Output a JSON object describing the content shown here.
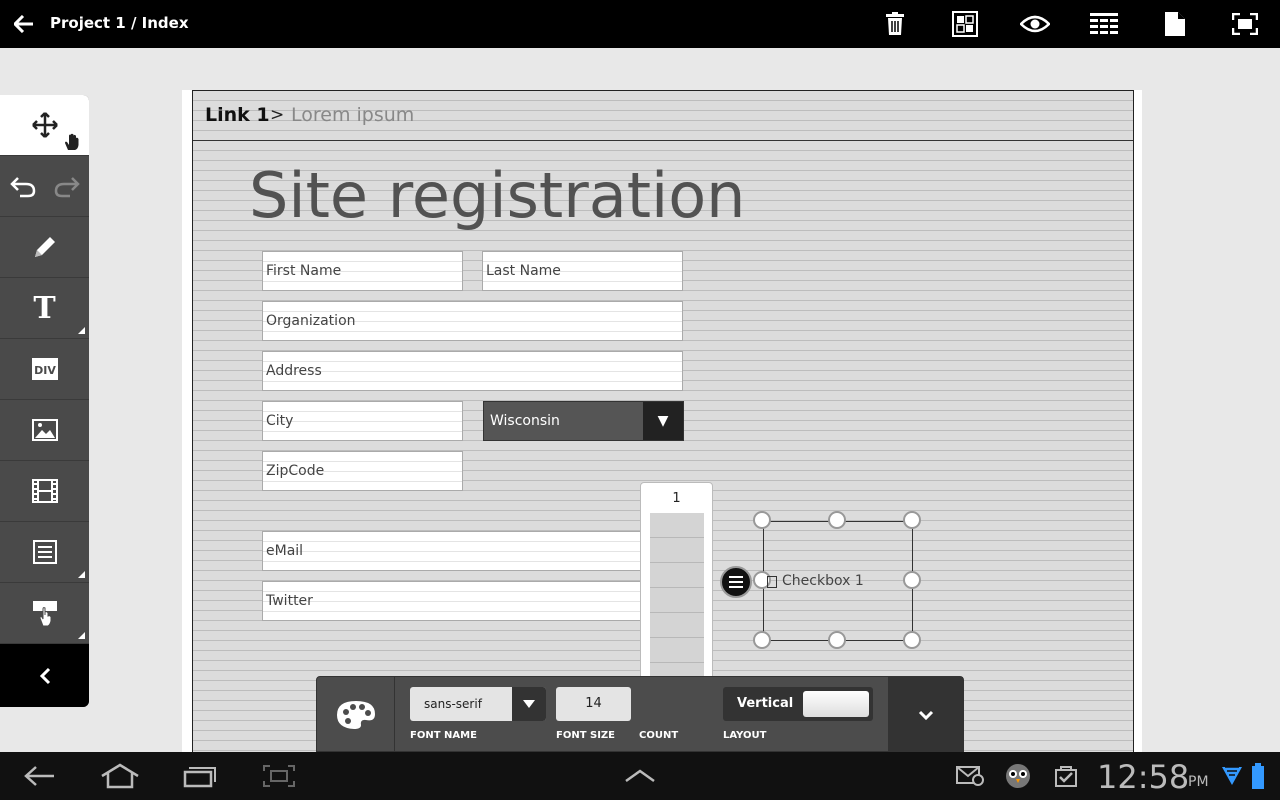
{
  "topbar": {
    "title": "Project 1 / Index",
    "icons": [
      "back-arrow-icon",
      "trash-icon",
      "grid-select-icon",
      "eye-icon",
      "list-grid-icon",
      "document-icon",
      "fullscreen-icon"
    ]
  },
  "breadcrumb": {
    "link": "Link 1",
    "separator": ">",
    "current": "Lorem ipsum"
  },
  "form": {
    "title": "Site registration",
    "first_name": "First Name",
    "last_name": "Last Name",
    "organization": "Organization",
    "address": "Address",
    "city": "City",
    "state_value": "Wisconsin",
    "state_arrow": "▼",
    "zipcode": "ZipCode",
    "email": "eMail",
    "twitter": "Twitter",
    "checkbox_label": "Checkbox 1"
  },
  "count_picker": {
    "value": "1"
  },
  "properties": {
    "font_name_value": "sans-serif",
    "font_name_label": "FONT NAME",
    "font_size_value": "14",
    "font_size_label": "FONT SIZE",
    "count_label": "COUNT",
    "layout_value": "Vertical",
    "layout_label": "LAYOUT"
  },
  "status": {
    "time": "12:58",
    "ampm": "PM"
  },
  "colors": {
    "topbar": "#000000",
    "tool_palette": "#4a4a4a",
    "canvas": "#dcdcdc",
    "select": "#555555"
  }
}
